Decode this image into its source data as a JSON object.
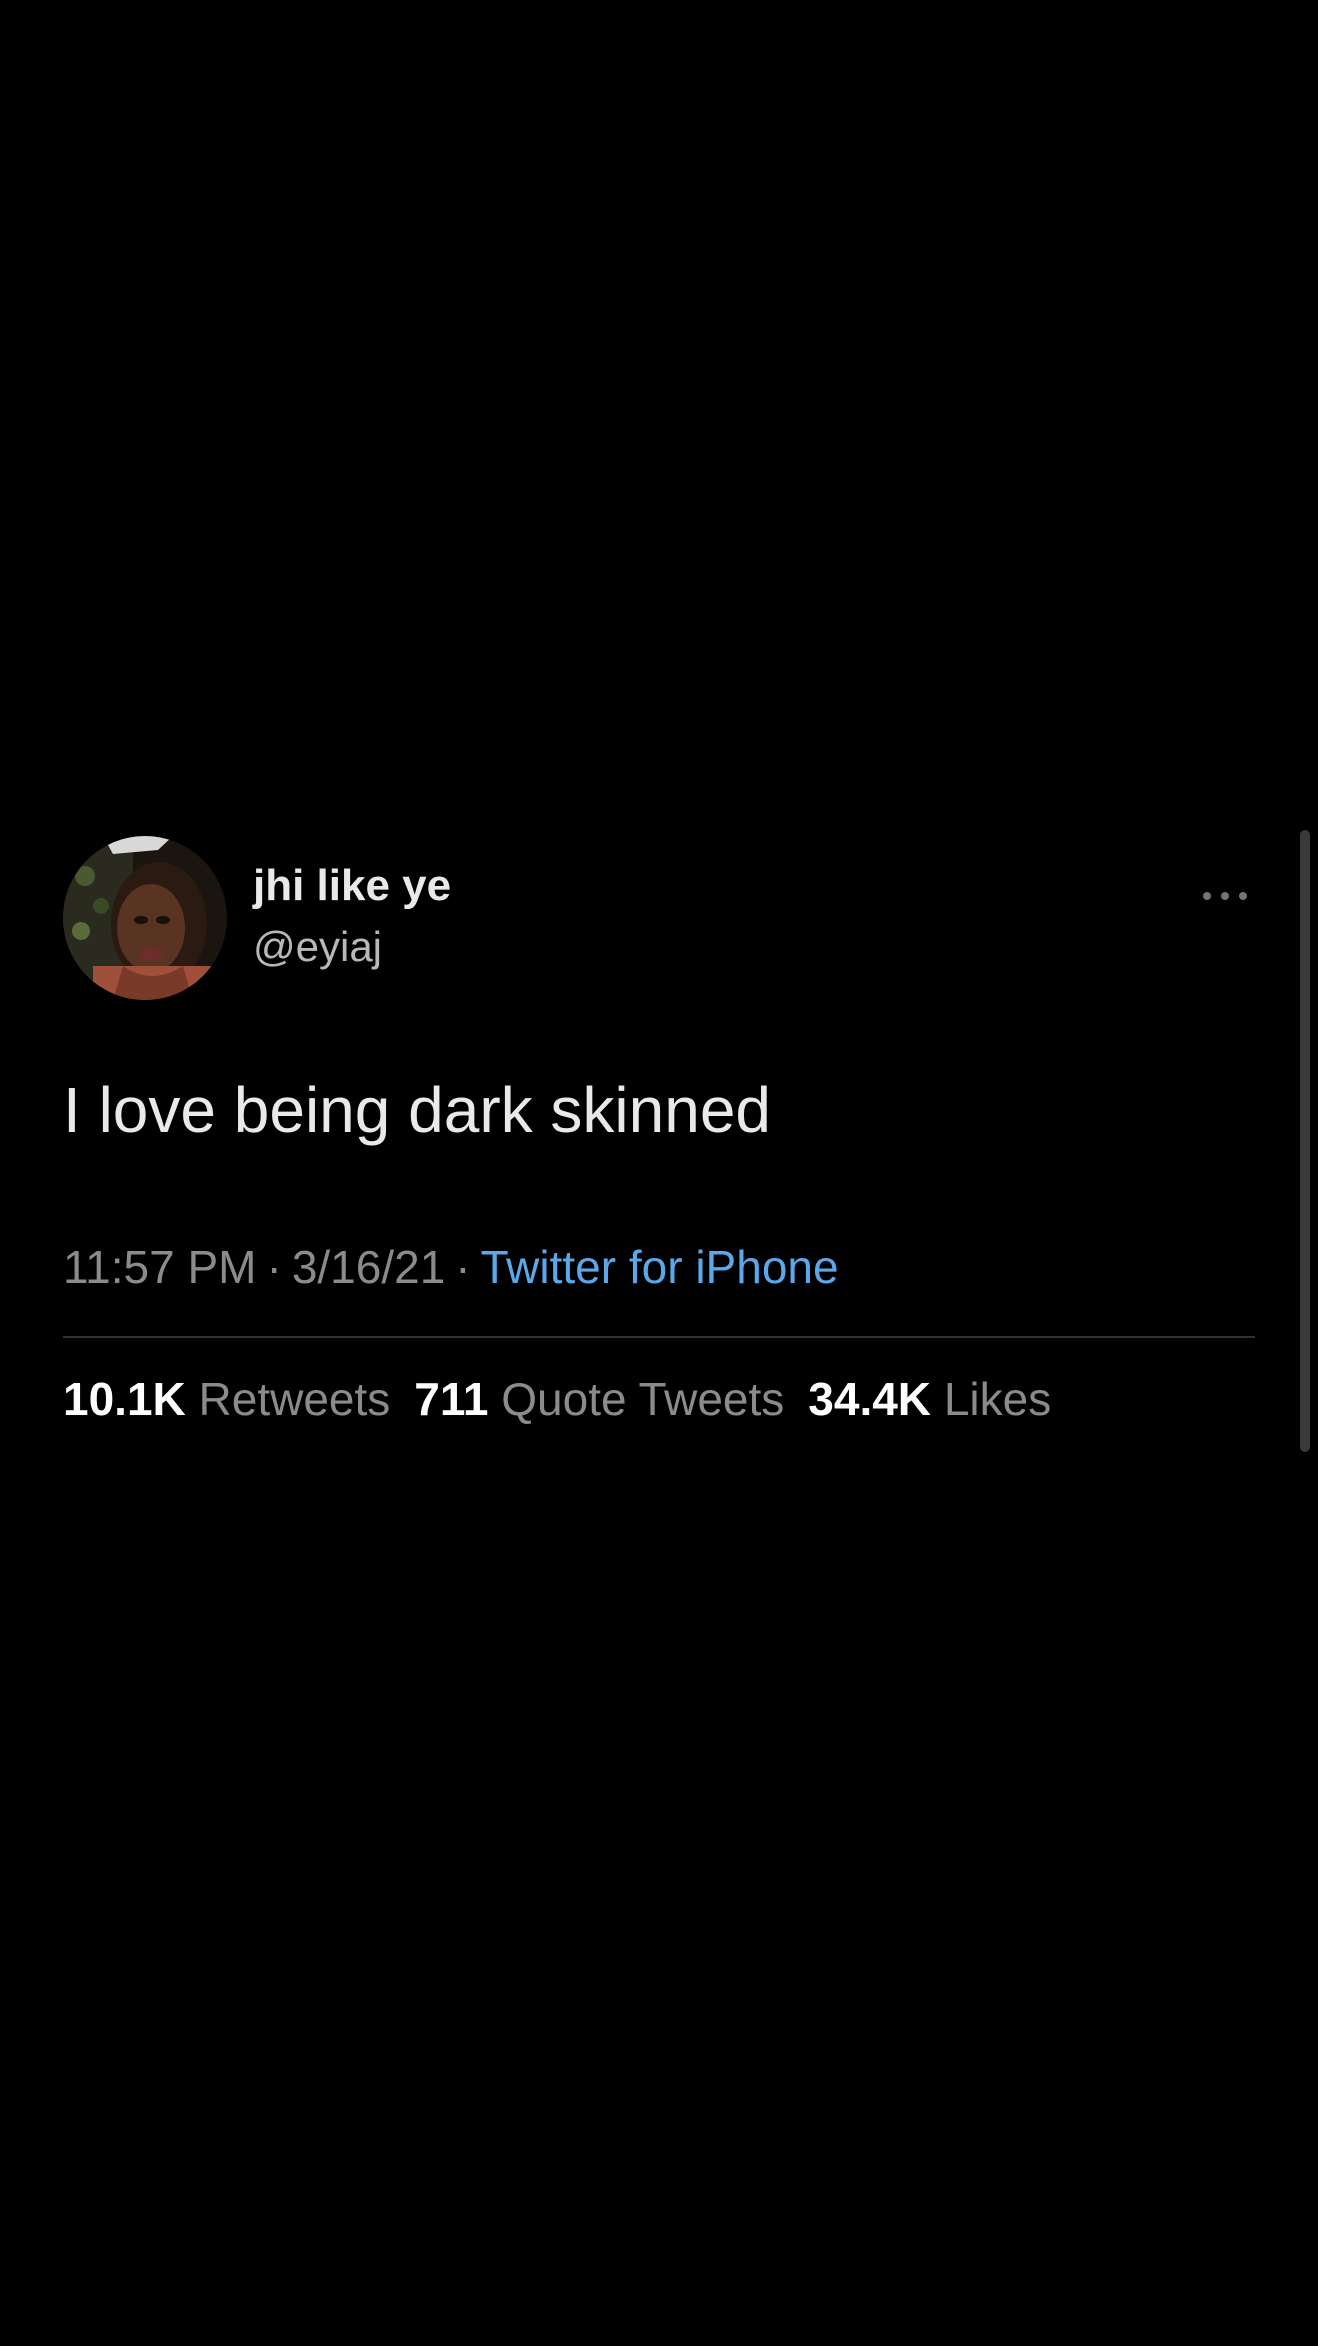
{
  "tweet": {
    "author": {
      "display_name": "jhi like ye",
      "handle": "@eyiaj"
    },
    "more_icon": "more-horizontal-icon",
    "text": "I love being dark skinned",
    "time": "11:57 PM",
    "separator": "·",
    "date": "3/16/21",
    "source": "Twitter for iPhone",
    "stats": [
      {
        "value": "10.1K",
        "label": "Retweets"
      },
      {
        "value": "711",
        "label": "Quote Tweets"
      },
      {
        "value": "34.4K",
        "label": "Likes"
      }
    ]
  },
  "colors": {
    "background": "#000000",
    "primary_text": "#e7e9ea",
    "secondary_text": "#8b8b8b",
    "link": "#5aa7ea",
    "divider": "#2f3336"
  }
}
